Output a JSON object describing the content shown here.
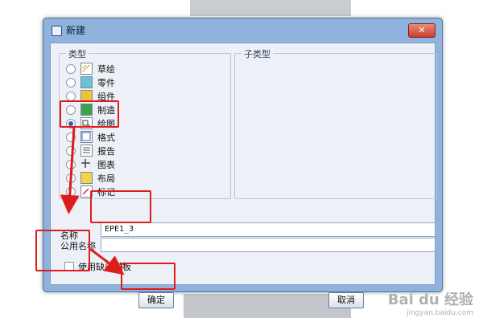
{
  "dialog": {
    "title": "新建",
    "close_label": "✕",
    "type_group_label": "类型",
    "subtype_group_label": "子类型",
    "types": [
      {
        "label": "草绘",
        "checked": false,
        "icon": "sketch-icon"
      },
      {
        "label": "零件",
        "checked": false,
        "icon": "part-icon"
      },
      {
        "label": "组件",
        "checked": false,
        "icon": "assembly-icon"
      },
      {
        "label": "制造",
        "checked": false,
        "icon": "manufacturing-icon"
      },
      {
        "label": "绘图",
        "checked": true,
        "icon": "drawing-icon"
      },
      {
        "label": "格式",
        "checked": false,
        "icon": "format-icon"
      },
      {
        "label": "报告",
        "checked": false,
        "icon": "report-icon"
      },
      {
        "label": "图表",
        "checked": false,
        "icon": "diagram-icon"
      },
      {
        "label": "布局",
        "checked": false,
        "icon": "layout-icon"
      },
      {
        "label": "标记",
        "checked": false,
        "icon": "markup-icon"
      }
    ],
    "name_label": "名称",
    "name_value": "EPE1_3",
    "common_name_label": "公用名称",
    "common_name_value": "",
    "use_default_template_label": "使用缺省模板",
    "use_default_template_checked": false,
    "ok_label": "确定",
    "cancel_label": "取消"
  },
  "watermark": {
    "brand": "Bai du 经验",
    "url": "jingyan.baidu.com"
  },
  "colors": {
    "annotation": "#e01b1b",
    "dialog_frame": "#8fb3dc",
    "selected_radio": "#2d63b3"
  }
}
